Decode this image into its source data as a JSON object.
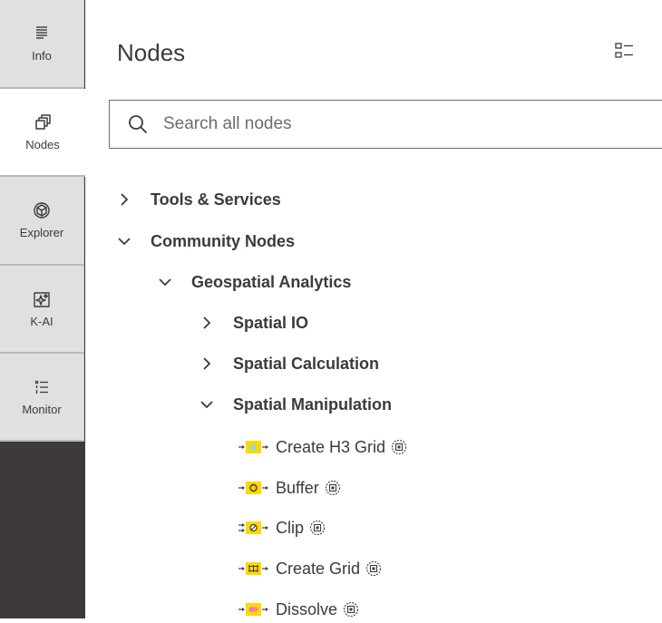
{
  "sidebar": {
    "items": [
      {
        "label": "Info",
        "icon": "info-lines-icon",
        "active": false
      },
      {
        "label": "Nodes",
        "icon": "nodes-copy-icon",
        "active": true
      },
      {
        "label": "Explorer",
        "icon": "cube-icon",
        "active": false
      },
      {
        "label": "K-AI",
        "icon": "ai-sparkle-icon",
        "active": false
      },
      {
        "label": "Monitor",
        "icon": "monitor-list-icon",
        "active": false
      }
    ]
  },
  "panel": {
    "title": "Nodes",
    "view_toggle_icon": "list-view-icon"
  },
  "search": {
    "placeholder": "Search all nodes",
    "value": ""
  },
  "tree": {
    "tools_services": {
      "label": "Tools & Services",
      "expanded": false
    },
    "community_nodes": {
      "label": "Community Nodes",
      "expanded": true
    },
    "geospatial_analytics": {
      "label": "Geospatial Analytics",
      "expanded": true
    },
    "spatial_io": {
      "label": "Spatial IO",
      "expanded": false
    },
    "spatial_calculation": {
      "label": "Spatial Calculation",
      "expanded": false
    },
    "spatial_manipulation": {
      "label": "Spatial Manipulation",
      "expanded": true
    },
    "nodes": [
      {
        "label": "Create H3 Grid",
        "icon": "create-h3-grid-node-icon"
      },
      {
        "label": "Buffer",
        "icon": "buffer-node-icon"
      },
      {
        "label": "Clip",
        "icon": "clip-node-icon"
      },
      {
        "label": "Create Grid",
        "icon": "create-grid-node-icon"
      },
      {
        "label": "Dissolve",
        "icon": "dissolve-node-icon"
      }
    ]
  },
  "colors": {
    "sidebar_dark": "#3e3a39",
    "sidebar_item": "#e0e0df",
    "text": "#3e3a39",
    "node_yellow": "#ffd800"
  }
}
